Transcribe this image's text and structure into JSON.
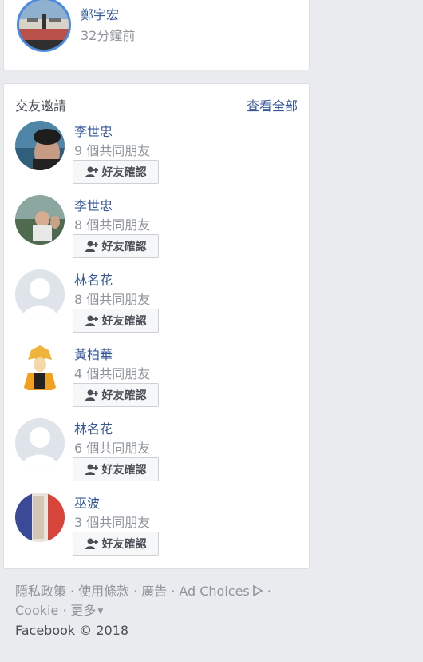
{
  "top_card": {
    "name": "鄭宇宏",
    "time": "32分鐘前"
  },
  "friend_requests": {
    "title": "交友邀請",
    "see_all": "查看全部",
    "confirm_label": "好友確認",
    "items": [
      {
        "name": "李世忠",
        "mutual": "9 個共同朋友"
      },
      {
        "name": "李世忠",
        "mutual": "8 個共同朋友"
      },
      {
        "name": "林名花",
        "mutual": "8 個共同朋友"
      },
      {
        "name": "黃柏華",
        "mutual": "4 個共同朋友"
      },
      {
        "name": "林名花",
        "mutual": "6 個共同朋友"
      },
      {
        "name": "巫波",
        "mutual": "3 個共同朋友"
      }
    ]
  },
  "footer": {
    "privacy": "隱私政策",
    "terms": "使用條款",
    "ads": "廣告",
    "ad_choices": "Ad Choices",
    "cookie": "Cookie",
    "more": "更多",
    "copyright": "Facebook © 2018"
  }
}
